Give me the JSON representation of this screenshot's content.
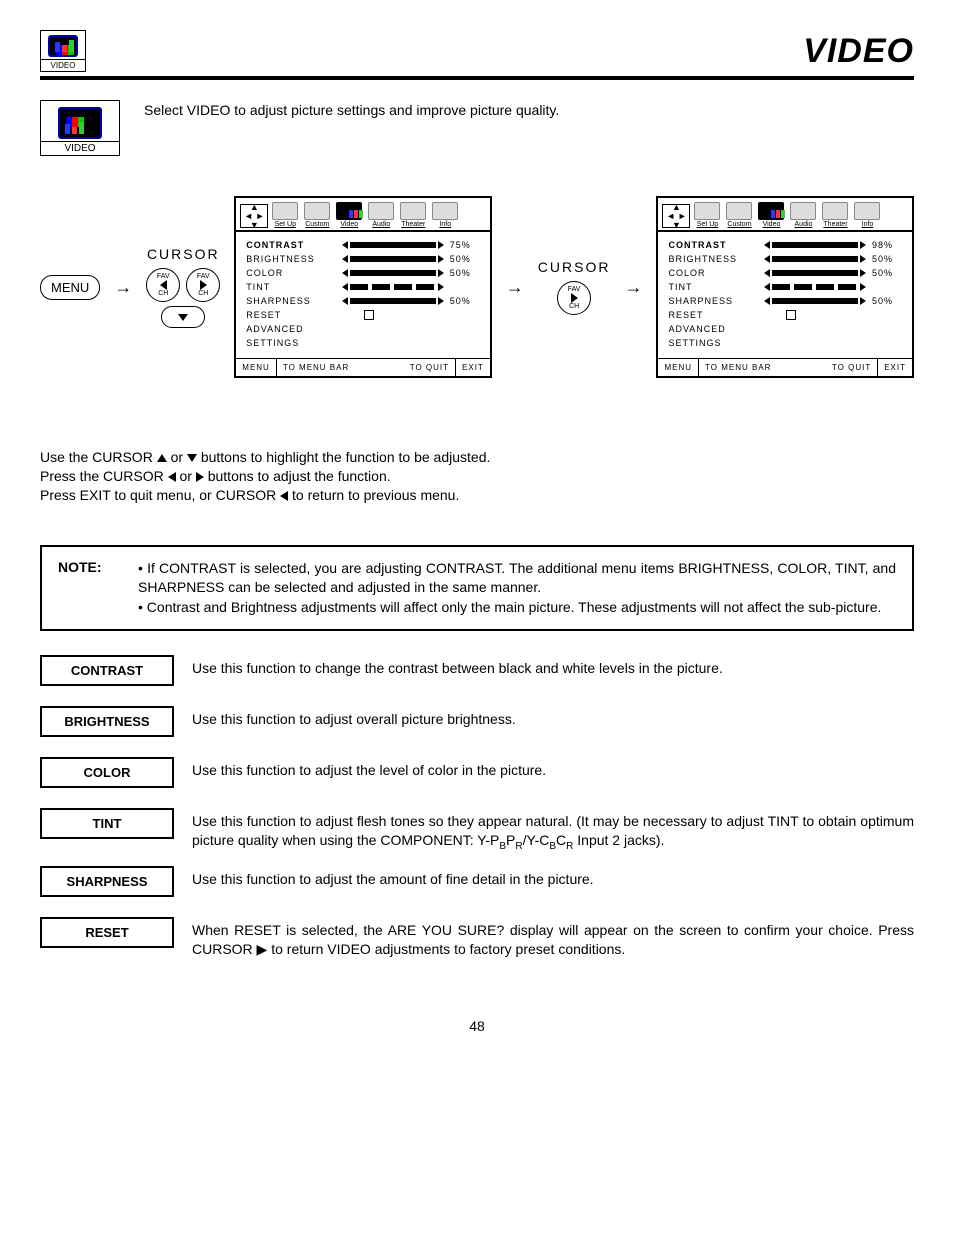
{
  "header": {
    "title": "VIDEO",
    "icon_label": "VIDEO"
  },
  "intro": {
    "icon_label": "VIDEO",
    "text": "Select VIDEO to adjust picture settings and improve picture quality."
  },
  "diagram": {
    "menu_label": "MENU",
    "cursor_label": "CURSOR",
    "fav_label": "FAV",
    "ch_label": "CH"
  },
  "osd_tabs": [
    "Set Up",
    "Custom",
    "Video",
    "Audio",
    "Theater",
    "Info"
  ],
  "osd1": {
    "rows": [
      {
        "name": "CONTRAST",
        "value": "75%",
        "bold": true,
        "type": "slider"
      },
      {
        "name": "BRIGHTNESS",
        "value": "50%",
        "type": "slider"
      },
      {
        "name": "COLOR",
        "value": "50%",
        "type": "slider"
      },
      {
        "name": "TINT",
        "value": "",
        "type": "split"
      },
      {
        "name": "SHARPNESS",
        "value": "50%",
        "type": "slider"
      },
      {
        "name": "RESET",
        "value": "",
        "type": "check"
      },
      {
        "name": "ADVANCED",
        "value": "",
        "type": "none"
      },
      {
        "name": "  SETTINGS",
        "value": "",
        "type": "none"
      }
    ]
  },
  "osd2": {
    "rows": [
      {
        "name": "CONTRAST",
        "value": "98%",
        "bold": true,
        "type": "slider"
      },
      {
        "name": "BRIGHTNESS",
        "value": "50%",
        "type": "slider"
      },
      {
        "name": "COLOR",
        "value": "50%",
        "type": "slider"
      },
      {
        "name": "TINT",
        "value": "",
        "type": "split"
      },
      {
        "name": "SHARPNESS",
        "value": "50%",
        "type": "slider"
      },
      {
        "name": "RESET",
        "value": "",
        "type": "check"
      },
      {
        "name": "ADVANCED",
        "value": "",
        "type": "none"
      },
      {
        "name": "  SETTINGS",
        "value": "",
        "type": "none"
      }
    ]
  },
  "osd_footer": {
    "menu": "MENU",
    "to_menu": "TO MENU BAR",
    "to_quit": "TO QUIT",
    "exit": "EXIT"
  },
  "instructions": {
    "l1a": "Use the CURSOR ",
    "l1b": " or ",
    "l1c": " buttons to highlight the function to be adjusted.",
    "l2a": "Press the CURSOR ",
    "l2b": " or ",
    "l2c": " buttons to adjust the function.",
    "l3a": "Press EXIT to quit menu, or CURSOR ",
    "l3b": " to return to previous menu."
  },
  "note": {
    "label": "NOTE:",
    "b1": "If CONTRAST is selected, you are adjusting CONTRAST.  The additional menu items BRIGHTNESS, COLOR, TINT, and SHARPNESS can be selected and adjusted in the same manner.",
    "b2": "Contrast and Brightness adjustments will affect only the main picture. These adjustments will not affect the sub-picture."
  },
  "definitions": [
    {
      "label": "CONTRAST",
      "text": "Use this function to change the contrast between black and white levels in the picture."
    },
    {
      "label": "BRIGHTNESS",
      "text": "Use this function to adjust overall picture brightness."
    },
    {
      "label": "COLOR",
      "text": "Use this function to adjust the level of color in the picture."
    },
    {
      "label": "TINT",
      "text": "Use this function to adjust flesh tones so they appear natural. (It may be necessary to adjust TINT to obtain optimum picture quality when using the COMPONENT: Y-P"
    },
    {
      "label": "SHARPNESS",
      "text": "Use this function to adjust the amount of fine detail in the picture."
    },
    {
      "label": "RESET",
      "text": "When RESET is selected, the  ARE YOU SURE?  display will appear on the screen to confirm your choice. Press CURSOR ▶ to return VIDEO adjustments to factory preset conditions."
    }
  ],
  "tint_suffix_parts": {
    "b": "B",
    "p": "P",
    "r": "R",
    "slash": "/Y-C",
    "c": "C",
    "end": " Input 2 jacks)."
  },
  "page_number": "48"
}
